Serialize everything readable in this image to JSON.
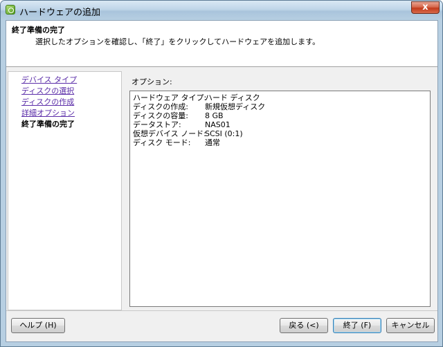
{
  "window": {
    "title": "ハードウェアの追加",
    "close_glyph": "x"
  },
  "header": {
    "title": "終了準備の完了",
    "description": "選択したオプションを確認し、「終了」をクリックしてハードウェアを追加します。"
  },
  "steps": [
    {
      "label": "デバイス タイプ",
      "state": "link"
    },
    {
      "label": "ディスクの選択",
      "state": "link"
    },
    {
      "label": "ディスクの作成",
      "state": "link"
    },
    {
      "label": "詳細オプション",
      "state": "link"
    },
    {
      "label": "終了準備の完了",
      "state": "current"
    }
  ],
  "options": {
    "label": "オプション:",
    "rows": [
      {
        "key": "ハードウェア タイプ:",
        "value": "ハード ディスク"
      },
      {
        "key": "ディスクの作成:",
        "value": "新規仮想ディスク"
      },
      {
        "key": "ディスクの容量:",
        "value": "8 GB"
      },
      {
        "key": "データストア:",
        "value": "NAS01"
      },
      {
        "key": "仮想デバイス ノード:",
        "value": "SCSI (0:1)"
      },
      {
        "key": "ディスク モード:",
        "value": "通常"
      }
    ]
  },
  "buttons": {
    "help": "ヘルプ (H)",
    "back": "戻る (<)",
    "finish": "終了 (F)",
    "cancel": "キャンセル"
  },
  "colors": {
    "link": "#5a2ca8",
    "titlebar": "#b7cfe2",
    "close": "#c23b1b"
  }
}
